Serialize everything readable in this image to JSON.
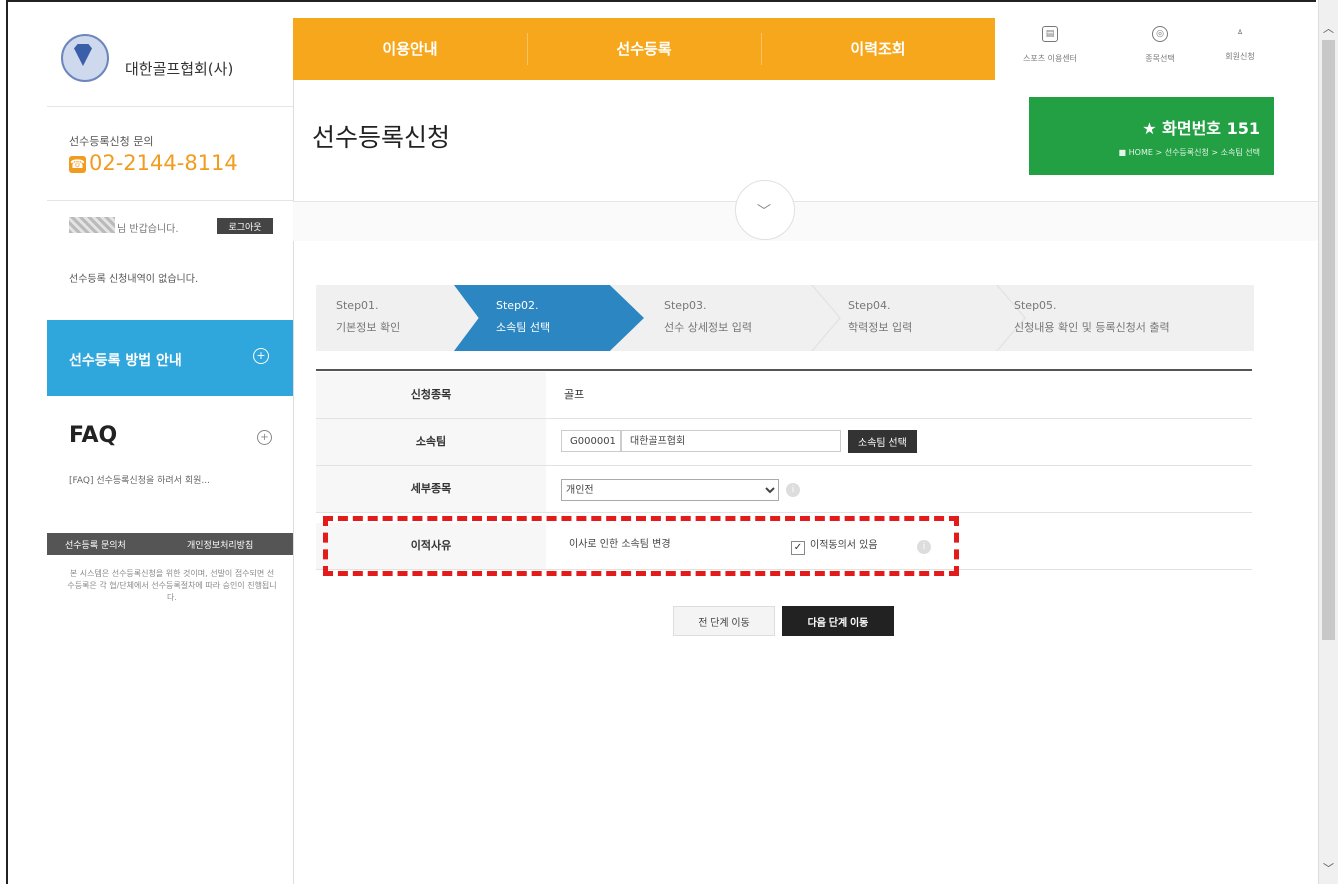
{
  "sidebar": {
    "org_name": "대한골프협회(사)",
    "contact_label": "선수등록신청 문의",
    "phone": "02-2144-8114",
    "welcome": "님 반갑습니다.",
    "logout": "로그아웃",
    "no_history": "선수등록 신청내역이 없습니다.",
    "guide": "선수등록 방법 안내",
    "faq_title": "FAQ",
    "faq_item": "[FAQ] 선수등록신청을 하려서 회원...",
    "bar_left": "선수등록 문의처",
    "bar_right": "개인정보처리방침",
    "note": "본 시스템은 선수등록신청을 위한 것이며, 선발이 접수되면 선수등록은 각 협/단체에서 선수등록절차에 따라 승인이 진행됩니다."
  },
  "nav": {
    "items": [
      "이용안내",
      "선수등록",
      "이력조회"
    ],
    "utils": [
      {
        "icon": "document-icon",
        "glyph": "▤",
        "label": "스포츠 이용센터"
      },
      {
        "icon": "register-icon",
        "glyph": "◎",
        "label": "종목선택"
      },
      {
        "icon": "user-icon",
        "glyph": "ㅿ",
        "label": "회원신청"
      }
    ]
  },
  "page": {
    "title": "선수등록신청",
    "screen_no": "★  화면번호 151",
    "breadcrumb": "■ HOME > 선수등록신청 > 소속팀 선택"
  },
  "steps": [
    {
      "num": "Step01.",
      "label": "기본정보 확인"
    },
    {
      "num": "Step02.",
      "label": "소속팀 선택"
    },
    {
      "num": "Step03.",
      "label": "선수 상세정보 입력"
    },
    {
      "num": "Step04.",
      "label": "학력정보 입력"
    },
    {
      "num": "Step05.",
      "label": "신청내용 확인 및 등록신청서 출력"
    }
  ],
  "form": {
    "event_label": "신청종목",
    "event_value": "골프",
    "team_label": "소속팀",
    "team_code": "G000001",
    "team_name": "대한골프협회",
    "team_btn": "소속팀 선택",
    "detail_label": "세부종목",
    "detail_value": "개인전",
    "reason_label": "이적사유",
    "reason_value": "이사로 인한 소속팀 변경",
    "consent_label": "이적동의서 있음"
  },
  "buttons": {
    "prev": "전 단계 이동",
    "next": "다음 단계 이동"
  },
  "colors": {
    "nav_orange": "#f7a71c",
    "step_blue": "#2b86c2",
    "guide_blue": "#2fa6dc",
    "screen_green": "#22a043",
    "highlight_red": "#e31b1b"
  }
}
